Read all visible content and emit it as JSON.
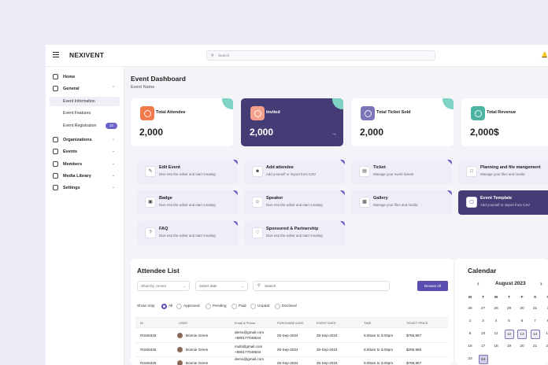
{
  "app": {
    "logo": "NEXIVENT",
    "search_placeholder": "Search"
  },
  "sidebar": {
    "items": [
      {
        "label": "Home"
      },
      {
        "label": "General"
      },
      {
        "label": "Event Information"
      },
      {
        "label": "Event Features"
      },
      {
        "label": "Event Registration",
        "badge": "10"
      },
      {
        "label": "Organizations"
      },
      {
        "label": "Events"
      },
      {
        "label": "Members"
      },
      {
        "label": "Media Library"
      },
      {
        "label": "Settings"
      }
    ]
  },
  "header": {
    "title": "Event Dashboard",
    "subtitle": "Event Name"
  },
  "stats": [
    {
      "label": "Total Attendee",
      "value": "2,000"
    },
    {
      "label": "Invited",
      "value": "2,000"
    },
    {
      "label": "Total Ticket Sold",
      "value": "2,000"
    },
    {
      "label": "Total Revenue",
      "value": "2,000$"
    }
  ],
  "actions": [
    {
      "title": "Edit Event",
      "desc": "Dive into the editor and start creating"
    },
    {
      "title": "Add attendee",
      "desc": "Add yourself or import from CSV"
    },
    {
      "title": "Ticket",
      "desc": "Manage your event tickets"
    },
    {
      "title": "Planning and file mangement",
      "desc": "Manage your files and media"
    },
    {
      "title": "Badge",
      "desc": "Dive into the editor and start creating"
    },
    {
      "title": "Speaker",
      "desc": "Dive into the editor and start creating"
    },
    {
      "title": "Gallery",
      "desc": "Manage your files and media"
    },
    {
      "title": "Event Template",
      "desc": "Add yourself or import from CSV"
    },
    {
      "title": "FAQ",
      "desc": "Dive into the editor and start creating"
    },
    {
      "title": "Sponsored & Partnership",
      "desc": "Dive into the editor and start creating"
    }
  ],
  "attendee": {
    "title": "Attendee List",
    "sort_label": "Short by: recent",
    "date_label": "Select date",
    "search_placeholder": "Search",
    "browse_label": "Browse All",
    "show_only": "Show only:",
    "filters": [
      "All",
      "Approved",
      "Pending",
      "Paid",
      "Unpaid",
      "Declined"
    ],
    "columns": [
      "ID",
      "USER",
      "Email & Phone",
      "PURCHASE DATE",
      "EVENT DATE",
      "TIME",
      "TICKET PRICE"
    ],
    "rows": [
      {
        "id": "#1846325",
        "user": "Bonnie Green",
        "email": "demo@gmail.com",
        "phone": "+880177049544",
        "purchase": "25-Sep-2024",
        "event": "25-Sep-2024",
        "time": "9.00am to 3.00pm",
        "price": "$768,967"
      },
      {
        "id": "#1846325",
        "user": "Bonnie Green",
        "email": "multi@gmail.com",
        "phone": "+880177049544",
        "purchase": "25-Sep-2024",
        "event": "25-Sep-2024",
        "time": "9.00am to 3.00pm",
        "price": "$265,965"
      },
      {
        "id": "#1846325",
        "user": "Bonnie Green",
        "email": "demo@gmail.com",
        "phone": "",
        "purchase": "25-Sep-2024",
        "event": "25-Sep-2024",
        "time": "9.00am to 3.00pm",
        "price": "$768,967"
      }
    ]
  },
  "calendar": {
    "title": "Calendar",
    "month": "August 2023",
    "prev": "‹",
    "next": "›",
    "weekdays": [
      "M",
      "T",
      "W",
      "T",
      "F",
      "S",
      "S"
    ],
    "days": [
      "26",
      "27",
      "28",
      "29",
      "30",
      "31",
      "1",
      "2",
      "3",
      "4",
      "5",
      "6",
      "7",
      "8",
      "9",
      "10",
      "11",
      "12",
      "13",
      "14",
      "15",
      "16",
      "17",
      "18",
      "19",
      "20",
      "21",
      "22",
      "23",
      "24"
    ]
  },
  "colors": {
    "accent": "#443c74",
    "primary": "#5a4fb0",
    "teal": "#7ed3c4",
    "orange": "#f07a4a"
  }
}
